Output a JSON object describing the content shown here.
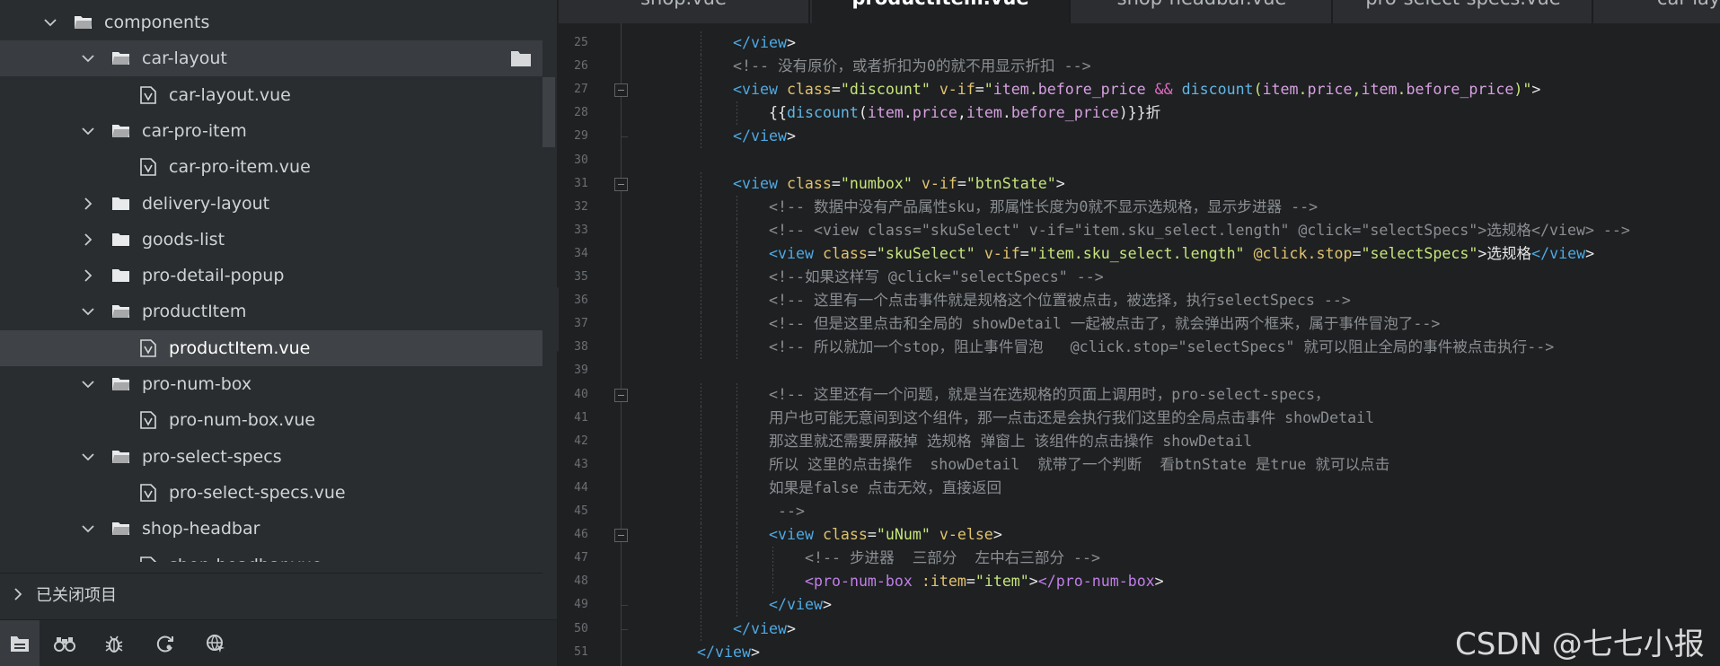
{
  "sidebar": {
    "tree": [
      {
        "label": "components",
        "type": "folder",
        "expanded": true,
        "depth": 0
      },
      {
        "label": "car-layout",
        "type": "folder",
        "expanded": true,
        "depth": 1,
        "hover": true
      },
      {
        "label": "car-layout.vue",
        "type": "file",
        "depth": 2
      },
      {
        "label": "car-pro-item",
        "type": "folder",
        "expanded": true,
        "depth": 1
      },
      {
        "label": "car-pro-item.vue",
        "type": "file",
        "depth": 2
      },
      {
        "label": "delivery-layout",
        "type": "folder",
        "expanded": false,
        "depth": 1
      },
      {
        "label": "goods-list",
        "type": "folder",
        "expanded": false,
        "depth": 1
      },
      {
        "label": "pro-detail-popup",
        "type": "folder",
        "expanded": false,
        "depth": 1
      },
      {
        "label": "productItem",
        "type": "folder",
        "expanded": true,
        "depth": 1
      },
      {
        "label": "productItem.vue",
        "type": "file",
        "depth": 2,
        "selected": true
      },
      {
        "label": "pro-num-box",
        "type": "folder",
        "expanded": true,
        "depth": 1
      },
      {
        "label": "pro-num-box.vue",
        "type": "file",
        "depth": 2
      },
      {
        "label": "pro-select-specs",
        "type": "folder",
        "expanded": true,
        "depth": 1
      },
      {
        "label": "pro-select-specs.vue",
        "type": "file",
        "depth": 2
      },
      {
        "label": "shop-headbar",
        "type": "folder",
        "expanded": true,
        "depth": 1
      },
      {
        "label": "shop-headbar.vue",
        "type": "file",
        "depth": 2
      }
    ],
    "closed_projects_label": "已关闭项目",
    "bottom_icons": [
      "project-manager-icon",
      "search-binoculars-icon",
      "debug-bug-icon",
      "git-icon",
      "browse-globe-icon"
    ]
  },
  "tabs": [
    {
      "label": "shop.vue",
      "active": false
    },
    {
      "label": "productItem.vue",
      "active": true
    },
    {
      "label": "shop-headbar.vue",
      "active": false
    },
    {
      "label": "pro-select-specs.vue",
      "active": false
    },
    {
      "label": "car-layout.vue",
      "active": false
    }
  ],
  "editor": {
    "lines": [
      {
        "n": "25",
        "indent": 2,
        "fold": false,
        "tokens": [
          [
            "t",
            "</view"
          ],
          [
            "d",
            ">"
          ]
        ]
      },
      {
        "n": "26",
        "indent": 2,
        "fold": false,
        "tokens": [
          [
            "c",
            "<!-- 没有原价，或者折扣为0的就不用显示折扣 -->"
          ]
        ]
      },
      {
        "n": "27",
        "indent": 2,
        "fold": true,
        "tokens": [
          [
            "t",
            "<view"
          ],
          [
            "d",
            " "
          ],
          [
            "a",
            "class"
          ],
          [
            "d",
            "="
          ],
          [
            "s",
            "\"discount\""
          ],
          [
            "d",
            " "
          ],
          [
            "a",
            "v-if"
          ],
          [
            "d",
            "="
          ],
          [
            "s",
            "\""
          ],
          [
            "v",
            "item"
          ],
          [
            "s",
            "."
          ],
          [
            "v",
            "before_price"
          ],
          [
            "s",
            " "
          ],
          [
            "o",
            "&&"
          ],
          [
            "s",
            " "
          ],
          [
            "f",
            "discount"
          ],
          [
            "s",
            "("
          ],
          [
            "v",
            "item"
          ],
          [
            "s",
            "."
          ],
          [
            "v",
            "price"
          ],
          [
            "s",
            ","
          ],
          [
            "v",
            "item"
          ],
          [
            "s",
            "."
          ],
          [
            "v",
            "before_price"
          ],
          [
            "s",
            ")\""
          ],
          [
            "d",
            ">"
          ]
        ]
      },
      {
        "n": "28",
        "indent": 3,
        "fold": false,
        "tokens": [
          [
            "d",
            "{{"
          ],
          [
            "f",
            "discount"
          ],
          [
            "d",
            "("
          ],
          [
            "v",
            "item"
          ],
          [
            "d",
            "."
          ],
          [
            "v",
            "price"
          ],
          [
            "d",
            ","
          ],
          [
            "v",
            "item"
          ],
          [
            "d",
            "."
          ],
          [
            "v",
            "before_price"
          ],
          [
            "d",
            ")}}折"
          ]
        ]
      },
      {
        "n": "29",
        "indent": 2,
        "fold": false,
        "tokens": [
          [
            "t",
            "</view"
          ],
          [
            "d",
            ">"
          ]
        ]
      },
      {
        "n": "30",
        "indent": 0,
        "fold": false,
        "tokens": []
      },
      {
        "n": "31",
        "indent": 2,
        "fold": true,
        "tokens": [
          [
            "t",
            "<view"
          ],
          [
            "d",
            " "
          ],
          [
            "a",
            "class"
          ],
          [
            "d",
            "="
          ],
          [
            "s",
            "\"numbox\""
          ],
          [
            "d",
            " "
          ],
          [
            "a",
            "v-if"
          ],
          [
            "d",
            "="
          ],
          [
            "s",
            "\"btnState\""
          ],
          [
            "d",
            ">"
          ]
        ]
      },
      {
        "n": "32",
        "indent": 3,
        "fold": false,
        "tokens": [
          [
            "c",
            "<!-- 数据中没有产品属性sku，那属性长度为0就不显示选规格，显示步进器 -->"
          ]
        ]
      },
      {
        "n": "33",
        "indent": 3,
        "fold": false,
        "tokens": [
          [
            "c",
            "<!-- <view class=\"skuSelect\" v-if=\"item.sku_select.length\" @click=\"selectSpecs\">选规格</view> -->"
          ]
        ]
      },
      {
        "n": "34",
        "indent": 3,
        "fold": false,
        "tokens": [
          [
            "t",
            "<view"
          ],
          [
            "d",
            " "
          ],
          [
            "a",
            "class"
          ],
          [
            "d",
            "="
          ],
          [
            "s",
            "\"skuSelect\""
          ],
          [
            "d",
            " "
          ],
          [
            "a",
            "v-if"
          ],
          [
            "d",
            "="
          ],
          [
            "s",
            "\"item.sku_select.length\""
          ],
          [
            "d",
            " "
          ],
          [
            "a",
            "@click.stop"
          ],
          [
            "d",
            "="
          ],
          [
            "s",
            "\"selectSpecs\""
          ],
          [
            "d",
            ">选规格"
          ],
          [
            "t",
            "</view"
          ],
          [
            "d",
            ">"
          ]
        ]
      },
      {
        "n": "35",
        "indent": 3,
        "fold": false,
        "tokens": [
          [
            "c",
            "<!--如果这样写 @click=\"selectSpecs\" -->"
          ]
        ]
      },
      {
        "n": "36",
        "indent": 3,
        "fold": false,
        "tokens": [
          [
            "c",
            "<!-- 这里有一个点击事件就是规格这个位置被点击，被选择，执行selectSpecs -->"
          ]
        ]
      },
      {
        "n": "37",
        "indent": 3,
        "fold": false,
        "tokens": [
          [
            "c",
            "<!-- 但是这里点击和全局的 showDetail 一起被点击了，就会弹出两个框来，属于事件冒泡了-->"
          ]
        ]
      },
      {
        "n": "38",
        "indent": 3,
        "fold": false,
        "tokens": [
          [
            "c",
            "<!-- 所以就加一个stop，阻止事件冒泡   @click.stop=\"selectSpecs\" 就可以阻止全局的事件被点击执行-->"
          ]
        ]
      },
      {
        "n": "39",
        "indent": 0,
        "fold": false,
        "tokens": []
      },
      {
        "n": "40",
        "indent": 3,
        "fold": true,
        "tokens": [
          [
            "c",
            "<!-- 这里还有一个问题，就是当在选规格的页面上调用时，pro-select-specs，"
          ]
        ]
      },
      {
        "n": "41",
        "indent": 3,
        "fold": false,
        "tokens": [
          [
            "c",
            "用户也可能无意间到这个组件，那一点击还是会执行我们这里的全局点击事件 showDetail"
          ]
        ]
      },
      {
        "n": "42",
        "indent": 3,
        "fold": false,
        "tokens": [
          [
            "c",
            "那这里就还需要屏蔽掉 选规格 弹窗上 该组件的点击操作 showDetail"
          ]
        ]
      },
      {
        "n": "43",
        "indent": 3,
        "fold": false,
        "tokens": [
          [
            "c",
            "所以 这里的点击操作  showDetail  就带了一个判断  看btnState 是true 就可以点击"
          ]
        ]
      },
      {
        "n": "44",
        "indent": 3,
        "fold": false,
        "tokens": [
          [
            "c",
            "如果是false 点击无效，直接返回"
          ]
        ]
      },
      {
        "n": "45",
        "indent": 3,
        "fold": false,
        "tokens": [
          [
            "c",
            " -->"
          ]
        ]
      },
      {
        "n": "46",
        "indent": 3,
        "fold": true,
        "tokens": [
          [
            "t",
            "<view"
          ],
          [
            "d",
            " "
          ],
          [
            "a",
            "class"
          ],
          [
            "d",
            "="
          ],
          [
            "s",
            "\"uNum\""
          ],
          [
            "d",
            " "
          ],
          [
            "a",
            "v-else"
          ],
          [
            "d",
            ">"
          ]
        ]
      },
      {
        "n": "47",
        "indent": 4,
        "fold": false,
        "tokens": [
          [
            "c",
            "<!-- 步进器  三部分  左中右三部分 -->"
          ]
        ]
      },
      {
        "n": "48",
        "indent": 4,
        "fold": false,
        "tokens": [
          [
            "cn",
            "<pro-num-box"
          ],
          [
            "d",
            " "
          ],
          [
            "a",
            ":item"
          ],
          [
            "d",
            "="
          ],
          [
            "s",
            "\"item\""
          ],
          [
            "d",
            ">"
          ],
          [
            "cn",
            "</pro-num-box"
          ],
          [
            "d",
            ">"
          ]
        ]
      },
      {
        "n": "49",
        "indent": 3,
        "fold": false,
        "tokens": [
          [
            "t",
            "</view"
          ],
          [
            "d",
            ">"
          ]
        ]
      },
      {
        "n": "50",
        "indent": 2,
        "fold": false,
        "tokens": [
          [
            "t",
            "</view"
          ],
          [
            "d",
            ">"
          ]
        ]
      },
      {
        "n": "51",
        "indent": 1,
        "fold": false,
        "tokens": [
          [
            "t",
            "</view"
          ],
          [
            "d",
            ">"
          ]
        ]
      }
    ]
  },
  "watermark": "CSDN @七七小报",
  "colors": {
    "sidebar_bg": "#2a2d30",
    "editor_bg": "#1e2022",
    "tag": "#4ea9e2",
    "attr": "#e2c26d",
    "string": "#c6e47a",
    "comment": "#8b8e91"
  }
}
